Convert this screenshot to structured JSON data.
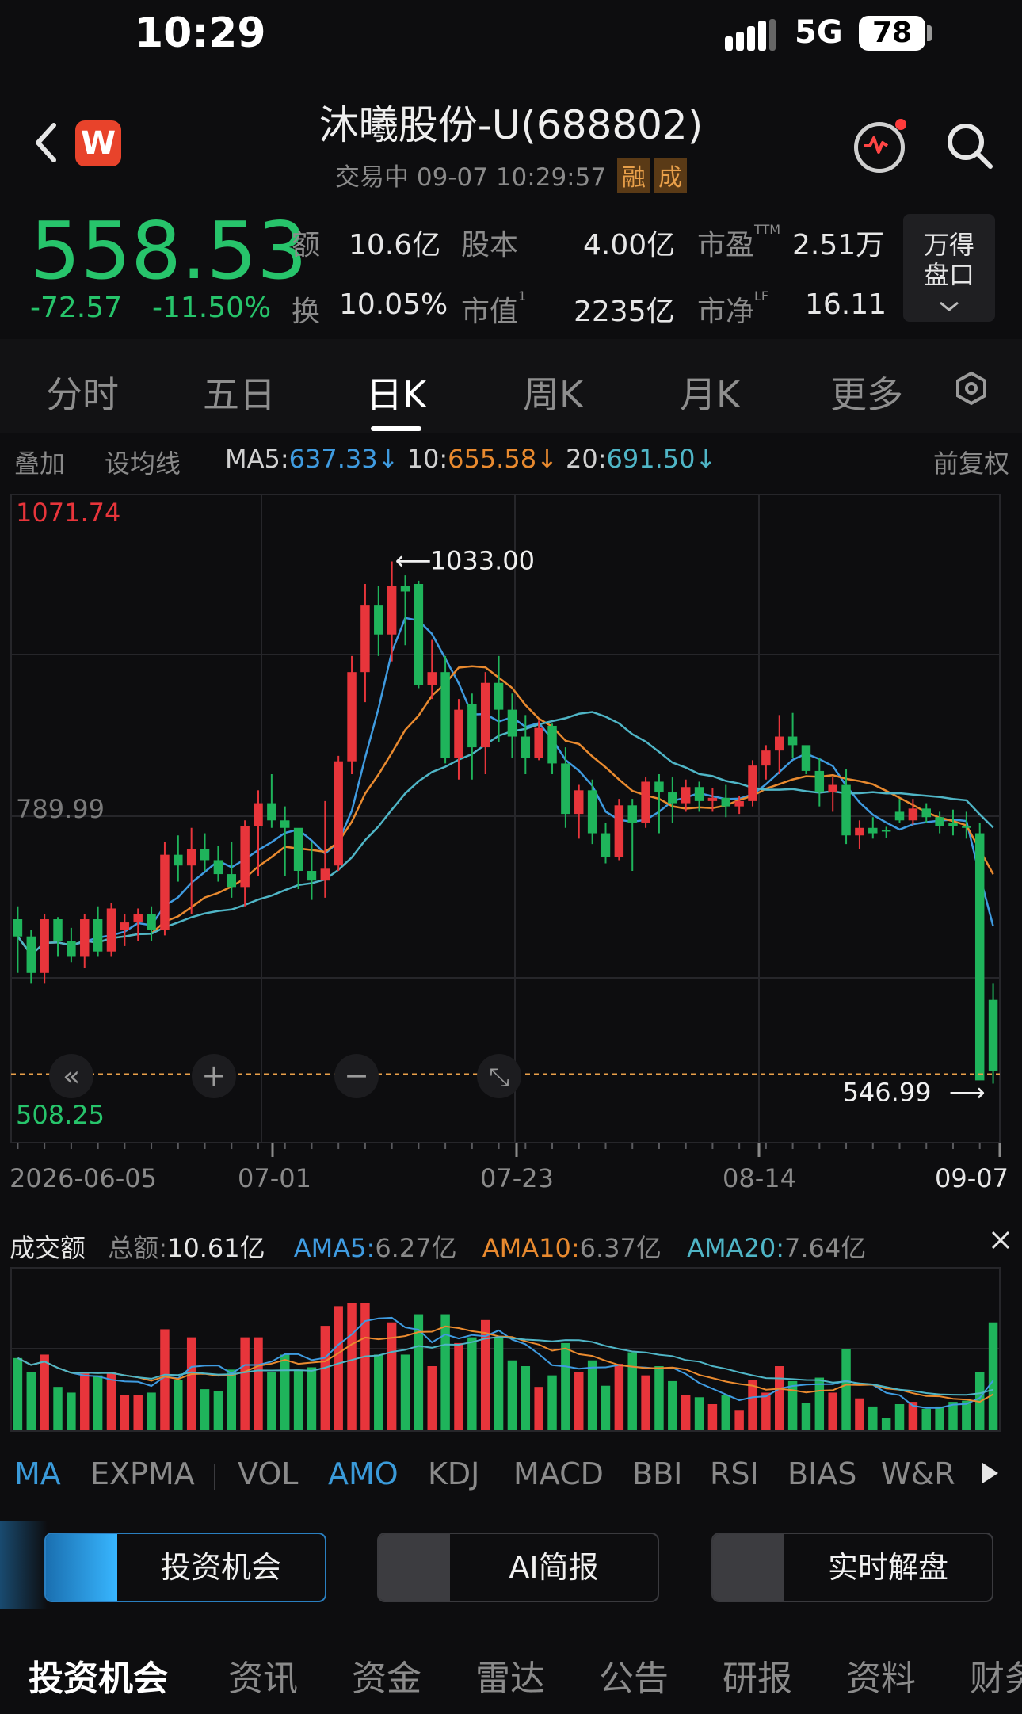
{
  "status_bar": {
    "time": "10:29",
    "network": "5G",
    "battery": "78"
  },
  "header": {
    "title": "沐曦股份-U(688802)",
    "status": "交易中",
    "datetime": "09-07 10:29:57",
    "tag_margin": "融",
    "tag_cheng": "成"
  },
  "quote": {
    "price": "558.53",
    "change": "-72.57",
    "change_pct": "-11.50%",
    "amount_label": "额",
    "amount": "10.6亿",
    "share_cap_label": "股本",
    "share_cap": "4.00亿",
    "pe_label": "市盈",
    "pe_sup": "TTM",
    "pe": "2.51万",
    "turnover_label": "换",
    "turnover": "10.05%",
    "mkt_cap_label": "市值",
    "mkt_cap_sup": "1",
    "mkt_cap": "2235亿",
    "pb_label": "市净",
    "pb_sup": "LF",
    "pb": "16.11",
    "wande_line1": "万得",
    "wande_line2": "盘口"
  },
  "period_tabs": [
    "分时",
    "五日",
    "日K",
    "周K",
    "月K",
    "更多"
  ],
  "active_period": "日K",
  "ma_bar": {
    "overlay": "叠加",
    "set_ma": "设均线",
    "ma5_label": "MA5:",
    "ma5": "637.33↓",
    "ma10_label": "10:",
    "ma10": "655.58↓",
    "ma20_label": "20:",
    "ma20": "691.50↓",
    "adjust": "前复权"
  },
  "colors": {
    "up": "#e8353b",
    "down": "#1fb45b",
    "ma5": "#3f9be0",
    "ma10": "#e98a2f",
    "ma20": "#4fb5c6",
    "bg": "#0d0d0f"
  },
  "chart_data": [
    {
      "type": "candlestick",
      "title": "",
      "y_axis_labels": [
        "1071.74",
        "789.99",
        "508.25"
      ],
      "ylim": [
        508.25,
        1071.74
      ],
      "x_tick_labels": [
        "2026-06-05",
        "07-01",
        "07-23",
        "08-14",
        "09-07"
      ],
      "high_marker": "1033.00",
      "low_marker": "546.99",
      "candles": [
        [
          700,
          712,
          650,
          684
        ],
        [
          684,
          690,
          640,
          650
        ],
        [
          650,
          705,
          640,
          700
        ],
        [
          700,
          702,
          665,
          680
        ],
        [
          680,
          692,
          660,
          665
        ],
        [
          665,
          705,
          655,
          700
        ],
        [
          700,
          712,
          665,
          670
        ],
        [
          670,
          715,
          665,
          710
        ],
        [
          690,
          705,
          675,
          697
        ],
        [
          697,
          710,
          680,
          705
        ],
        [
          705,
          712,
          680,
          690
        ],
        [
          690,
          772,
          685,
          760
        ],
        [
          760,
          778,
          735,
          750
        ],
        [
          750,
          785,
          705,
          765
        ],
        [
          765,
          780,
          745,
          755
        ],
        [
          755,
          768,
          735,
          742
        ],
        [
          742,
          772,
          720,
          730
        ],
        [
          730,
          792,
          712,
          787
        ],
        [
          787,
          820,
          740,
          808
        ],
        [
          808,
          835,
          785,
          792
        ],
        [
          792,
          805,
          740,
          785
        ],
        [
          785,
          780,
          728,
          745
        ],
        [
          745,
          772,
          718,
          736
        ],
        [
          736,
          810,
          720,
          747
        ],
        [
          750,
          852,
          745,
          847
        ],
        [
          847,
          945,
          835,
          930
        ],
        [
          930,
          1012,
          902,
          992
        ],
        [
          992,
          1010,
          945,
          965
        ],
        [
          965,
          1033,
          940,
          1010
        ],
        [
          1010,
          1020,
          955,
          1005
        ],
        [
          1012,
          1015,
          915,
          918
        ],
        [
          918,
          960,
          905,
          930
        ],
        [
          930,
          945,
          845,
          850
        ],
        [
          850,
          905,
          830,
          895
        ],
        [
          900,
          910,
          830,
          860
        ],
        [
          860,
          930,
          835,
          920
        ],
        [
          920,
          945,
          865,
          895
        ],
        [
          895,
          910,
          850,
          870
        ],
        [
          870,
          890,
          835,
          850
        ],
        [
          850,
          885,
          848,
          878
        ],
        [
          880,
          882,
          835,
          845
        ],
        [
          845,
          860,
          785,
          798
        ],
        [
          798,
          825,
          775,
          820
        ],
        [
          820,
          830,
          770,
          780
        ],
        [
          780,
          790,
          752,
          758
        ],
        [
          758,
          812,
          755,
          806
        ],
        [
          806,
          812,
          745,
          790
        ],
        [
          790,
          832,
          785,
          828
        ],
        [
          828,
          835,
          780,
          818
        ],
        [
          818,
          832,
          790,
          808
        ],
        [
          808,
          830,
          800,
          823
        ],
        [
          823,
          828,
          800,
          810
        ],
        [
          810,
          822,
          800,
          813
        ],
        [
          813,
          825,
          795,
          805
        ],
        [
          805,
          815,
          798,
          810
        ],
        [
          810,
          848,
          805,
          843
        ],
        [
          843,
          862,
          830,
          857
        ],
        [
          857,
          890,
          835,
          870
        ],
        [
          870,
          892,
          850,
          862
        ],
        [
          862,
          858,
          835,
          838
        ],
        [
          838,
          850,
          805,
          818
        ],
        [
          818,
          832,
          800,
          825
        ],
        [
          825,
          840,
          770,
          778
        ],
        [
          778,
          792,
          765,
          785
        ],
        [
          785,
          795,
          775,
          780
        ],
        [
          783,
          786,
          776,
          782
        ],
        [
          800,
          812,
          790,
          792
        ],
        [
          792,
          812,
          788,
          803
        ],
        [
          803,
          808,
          790,
          795
        ],
        [
          795,
          800,
          780,
          787
        ],
        [
          790,
          802,
          778,
          787
        ],
        [
          787,
          800,
          775,
          785
        ],
        [
          780,
          790,
          740,
          550
        ],
        [
          625,
          640,
          547,
          558.53
        ]
      ],
      "volume_panel": {
        "title": "成交额",
        "total_label": "总额:",
        "total": "10.61亿",
        "ama5_label": "AMA5:",
        "ama5": "6.27亿",
        "ama10_label": "AMA10:",
        "ama10": "6.37亿",
        "ama20_label": "AMA20:",
        "ama20": "7.64亿"
      }
    }
  ],
  "indicator_tabs": [
    "MA",
    "EXPMA",
    "VOL",
    "AMO",
    "KDJ",
    "MACD",
    "BBI",
    "RSI",
    "BIAS",
    "W&R"
  ],
  "active_indicators": [
    "MA",
    "AMO"
  ],
  "action_buttons": [
    "投资机会",
    "AI简报",
    "实时解盘"
  ],
  "bottom_nav": [
    "投资机会",
    "资讯",
    "资金",
    "雷达",
    "公告",
    "研报",
    "资料",
    "财务"
  ]
}
